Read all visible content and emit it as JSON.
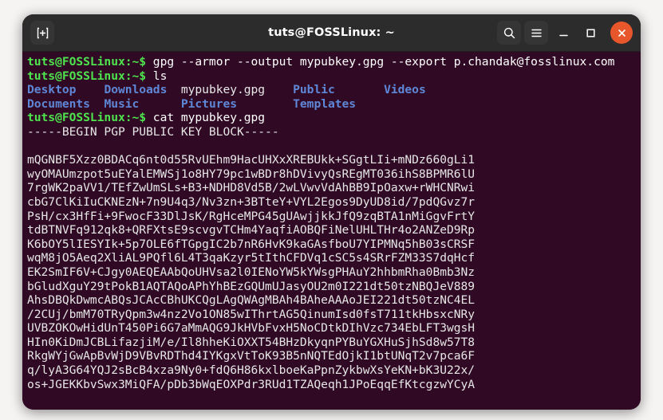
{
  "window": {
    "title": "tuts@FOSSLinux: ~",
    "titlebar": {
      "new_tab_label": "new-tab",
      "search_label": "search",
      "menu_label": "menu",
      "minimize_label": "minimize",
      "maximize_label": "maximize",
      "close_label": "close"
    },
    "colors": {
      "terminal_background": "#300a24",
      "titlebar_background": "#2c2c2c",
      "close_button": "#e8562b",
      "prompt_green": "#4ee44e",
      "directory_blue": "#5f87d7",
      "text_white": "#e6e6e6"
    }
  },
  "terminal": {
    "prompt": "tuts@FOSSLinux:~$",
    "lines": [
      {
        "type": "command",
        "prompt": "tuts@FOSSLinux:~$",
        "command": " gpg --armor --output mypubkey.gpg --export p.chandak@fosslinux.com"
      },
      {
        "type": "command",
        "prompt": "tuts@FOSSLinux:~$",
        "command": " ls"
      },
      {
        "type": "ls-row",
        "cells": [
          {
            "text": "Desktop",
            "kind": "dir"
          },
          {
            "text": "Downloads",
            "kind": "dir"
          },
          {
            "text": "mypubkey.gpg",
            "kind": "file"
          },
          {
            "text": "Public",
            "kind": "dir"
          },
          {
            "text": "Videos",
            "kind": "dir"
          }
        ]
      },
      {
        "type": "ls-row",
        "cells": [
          {
            "text": "Documents",
            "kind": "dir"
          },
          {
            "text": "Music",
            "kind": "dir"
          },
          {
            "text": "Pictures",
            "kind": "dir"
          },
          {
            "text": "Templates",
            "kind": "dir"
          }
        ]
      },
      {
        "type": "command",
        "prompt": "tuts@FOSSLinux:~$",
        "command": " cat mypubkey.gpg"
      },
      {
        "type": "output",
        "text": "-----BEGIN PGP PUBLIC KEY BLOCK-----"
      },
      {
        "type": "blank",
        "text": ""
      },
      {
        "type": "output",
        "text": "mQGNBF5Xzz0BDACq6nt0d55RvUEhm9HacUHXxXREBUkk+SGgtLIi+mNDz660gLi1"
      },
      {
        "type": "output",
        "text": "wyOMAUmzpot5uEYalEMWSj1o8HY79pc1wBDr8hDVivyQsREgMT036ihS8BPMR6lU"
      },
      {
        "type": "output",
        "text": "7rgWK2paVV1/TEfZwUmSLs+B3+NDHD8Vd5B/2wLVwvVdAhBB9IpOaxw+rWHCNRwi"
      },
      {
        "type": "output",
        "text": "cbG7ClKiIuCKNEzN+7n9U4q3/Nv3zn+3BTteY+VYL2Egos9DyUD8id/7pdQGvz7r"
      },
      {
        "type": "output",
        "text": "PsH/cx3HfFi+9FwocF33DlJsK/RgHceMPG45gUAwjjkkJfQ9zqBTA1nMiGgvFrtY"
      },
      {
        "type": "output",
        "text": "tdBTNVFq912qk8+QRFXtsE9scvgvTCHm4YaqfiAOBQFiNelUHLTHr4o2ANZeD9Rp"
      },
      {
        "type": "output",
        "text": "K6bOY5lIESYIk+5p7OLE6fTGpgIC2b7nR6HvK9kaGAsfboU7YIPMNq5hB03sCRSF"
      },
      {
        "type": "output",
        "text": "wqM8jO5Aeq2XliAL9PQfl6L4T3qaKzyr5tIthCFDVq1cSC5s4SRrFZM33S7dqHcf"
      },
      {
        "type": "output",
        "text": "EK2SmIF6V+CJgy0AEQEAAbQoUHVsa2l0IENoYW5kYWsgPHAuY2hhbmRha0Bmb3Nz"
      },
      {
        "type": "output",
        "text": "bGludXguY29tPokB1AQTAQoAPhYhBEzGQUmUJasyOU2m0I221dt50tzNBQJeV889"
      },
      {
        "type": "output",
        "text": "AhsDBQkDwmcABQsJCAcCBhUKCQgLAgQWAgMBAh4BAheAAAoJEI221dt50tzNC4EL"
      },
      {
        "type": "output",
        "text": "/2CUj/bmM70TRyQpm3w4nz2Vo1ON85wIThrtAG5QinumIsd0fsT711tkHbsxcNRy"
      },
      {
        "type": "output",
        "text": "UVBZOKOwHidUnT450Pi6G7aMmAQG9JkHVbFvxH5NoCDtkDIhVzc734EbLFT3wgsH"
      },
      {
        "type": "output",
        "text": "HIn0KiDmJCBLifazjiM/e/Il8hheKiOXXT54BHzDkyqnPYBuYGXHuSjhSd8w57T8"
      },
      {
        "type": "output",
        "text": "RkgWYjGwApBvWjD9VBvRDThd4IYKgxVtToK93B5nNQTEdOjkI1btUNqT2v7pca6F"
      },
      {
        "type": "output",
        "text": "q/lyA3G64YQJ2sBcB4xza9Ny0+fdQ6H86kxlboeKaPpnZykbwXsYeKN+bK3U22x/"
      },
      {
        "type": "output",
        "text": "os+JGEKKbvSwx3MiQFA/pDb3bWqEOXPdr3RUd1TZAQeqh1JPoEqqEfKtcgzwYCyA"
      }
    ]
  }
}
